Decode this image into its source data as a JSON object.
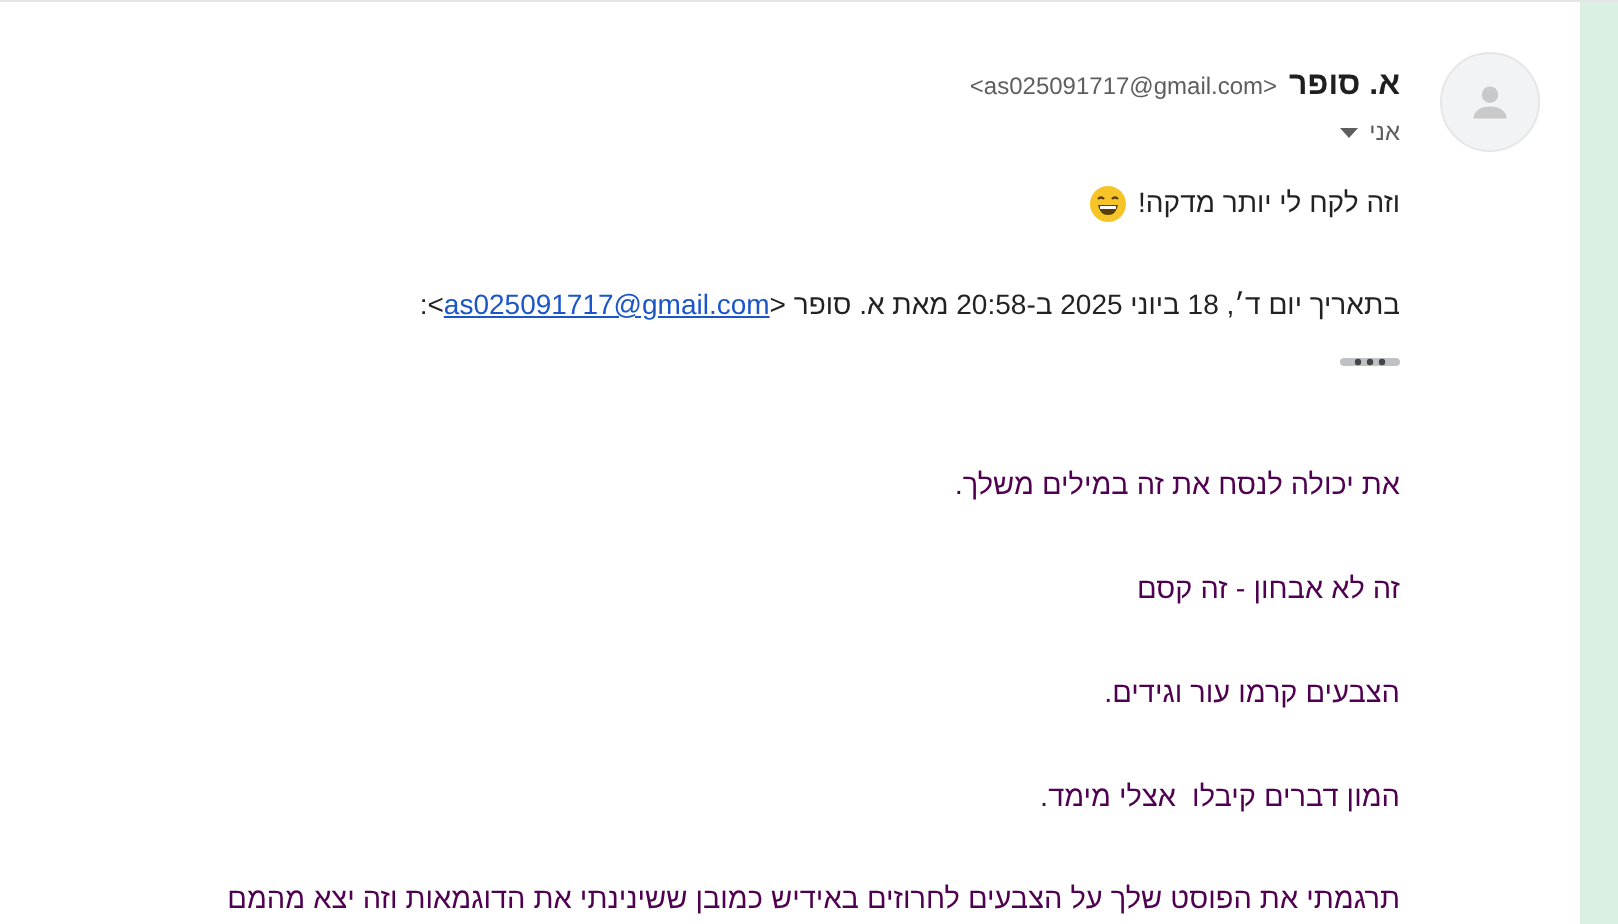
{
  "sender": {
    "name": "א. סופר",
    "email": "<as025091717@gmail.com>",
    "recipient": "אני"
  },
  "reply": {
    "text": "וזה לקח לי יותר מדקה!"
  },
  "quote_header": {
    "prefix": "בתאריך יום ד׳, 18 ביוני 2025 ב-20:58 מאת א. סופר <",
    "link": "as025091717@gmail.com",
    "suffix": ">:"
  },
  "quoted_paragraphs": [
    "את יכולה לנסח את זה במילים משלך.",
    "זה לא אבחון - זה קסם",
    "הצבעים קרמו עור וגידים.",
    "המון דברים קיבלו  אצלי מימד.",
    "תרגמתי את הפוסט שלך על הצבעים לחרוזים באידיש כמובן ששינינתי את הדוגמאות וזה יצא מהמם"
  ]
}
